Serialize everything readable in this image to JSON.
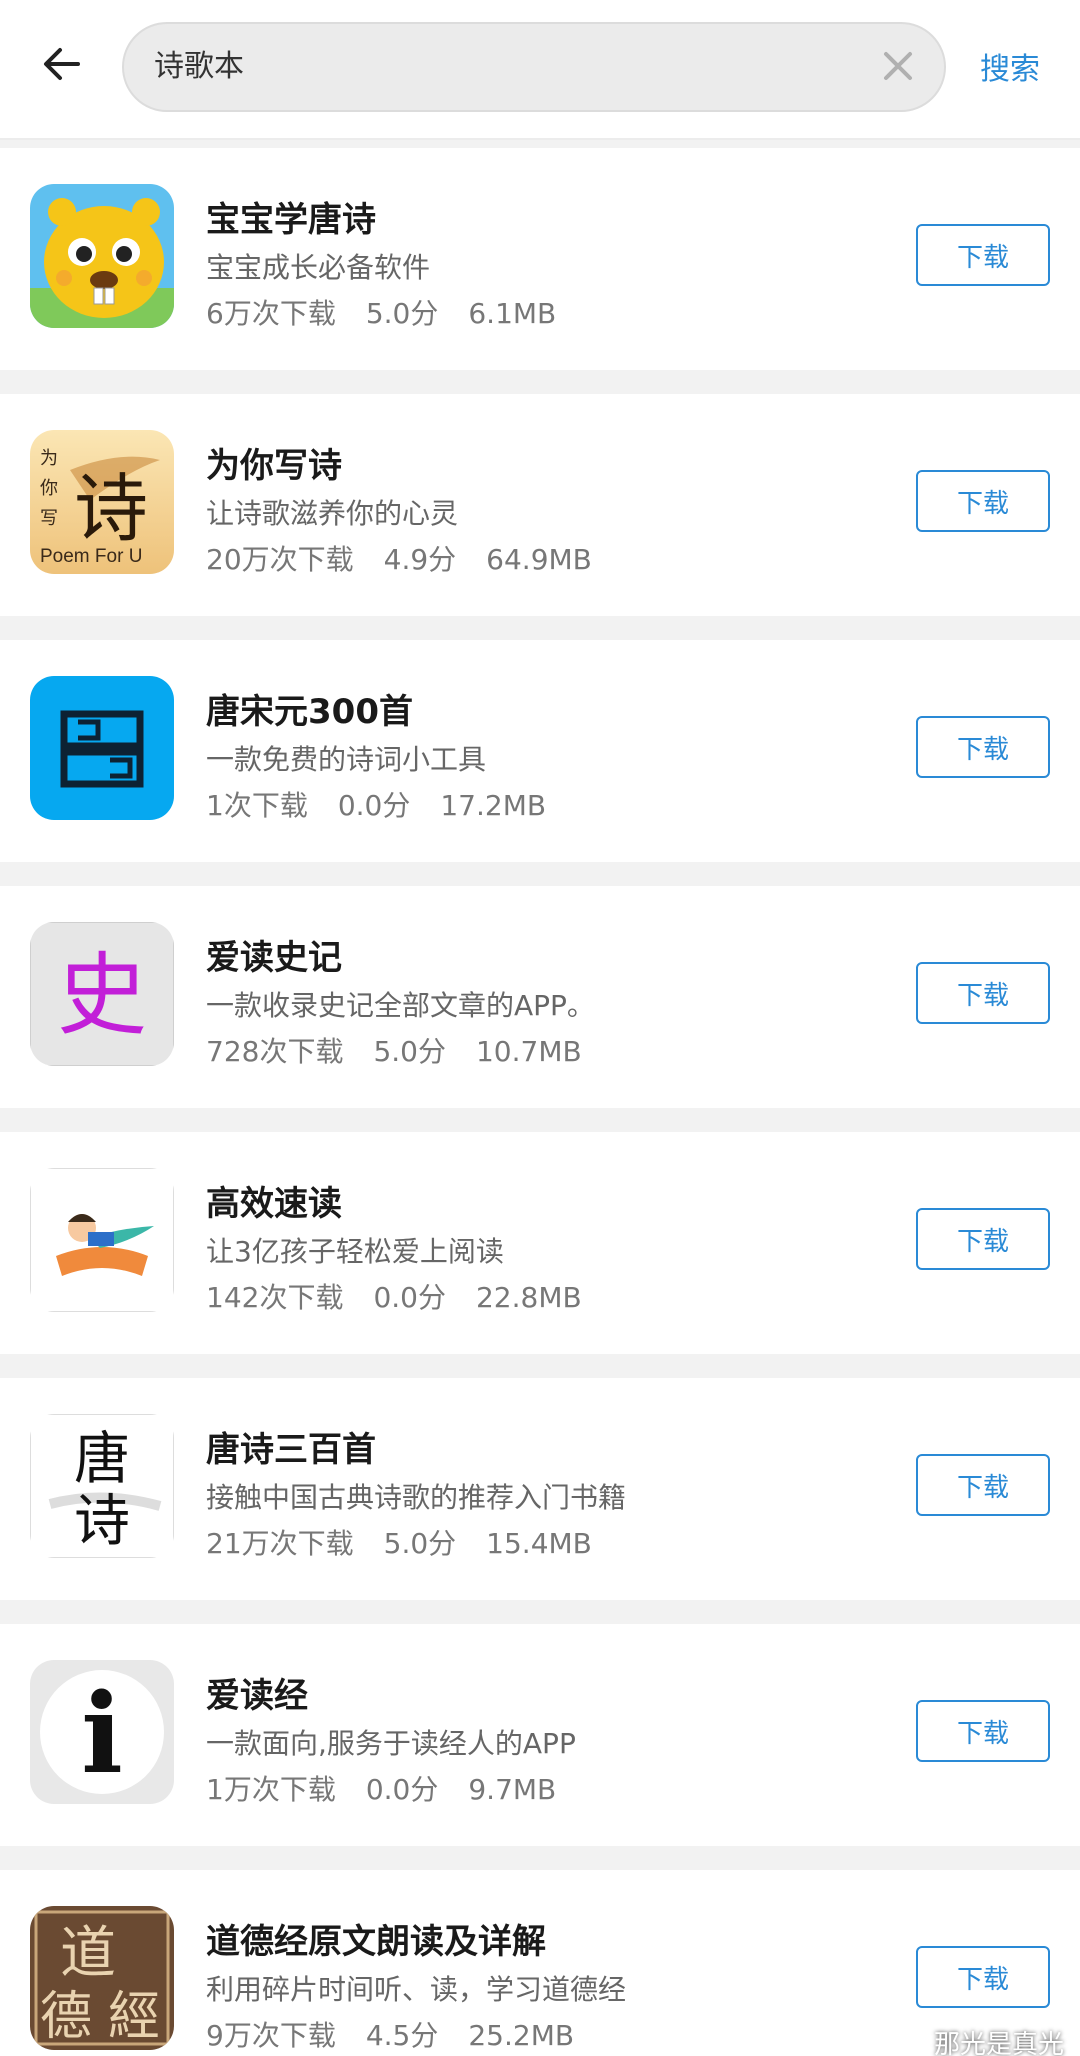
{
  "header": {
    "search_value": "诗歌本",
    "search_button": "搜索"
  },
  "apps": [
    {
      "name": "宝宝学唐诗",
      "desc": "宝宝成长必备软件",
      "downloads": "6万次下载",
      "rating": "5.0分",
      "size": "6.1MB",
      "button": "下载",
      "icon": "beaver-cartoon-icon"
    },
    {
      "name": "为你写诗",
      "desc": "让诗歌滋养你的心灵",
      "downloads": "20万次下载",
      "rating": "4.9分",
      "size": "64.9MB",
      "button": "下载",
      "icon": "poem-calligraphy-icon",
      "icon_text": "Poem For U",
      "icon_glyphs": [
        "为",
        "你",
        "写",
        "诗"
      ]
    },
    {
      "name": "唐宋元300首",
      "desc": "一款免费的诗词小工具",
      "downloads": "1次下载",
      "rating": "0.0分",
      "size": "17.2MB",
      "button": "下载",
      "icon": "book-stack-icon"
    },
    {
      "name": "爱读史记",
      "desc": "一款收录史记全部文章的APP。",
      "downloads": "728次下载",
      "rating": "5.0分",
      "size": "10.7MB",
      "button": "下载",
      "icon": "shi-character-icon",
      "icon_glyphs": [
        "史"
      ]
    },
    {
      "name": "高效速读",
      "desc": "让3亿孩子轻松爱上阅读",
      "downloads": "142次下载",
      "rating": "0.0分",
      "size": "22.8MB",
      "button": "下载",
      "icon": "child-reading-icon"
    },
    {
      "name": "唐诗三百首",
      "desc": "接触中国古典诗歌的推荐入门书籍",
      "downloads": "21万次下载",
      "rating": "5.0分",
      "size": "15.4MB",
      "button": "下载",
      "icon": "tangshi-calligraphy-icon",
      "icon_glyphs": [
        "唐",
        "诗"
      ]
    },
    {
      "name": "爱读经",
      "desc": "一款面向,服务于读经人的APP",
      "downloads": "1万次下载",
      "rating": "0.0分",
      "size": "9.7MB",
      "button": "下载",
      "icon": "letter-i-icon",
      "icon_glyphs": [
        "i"
      ]
    },
    {
      "name": "道德经原文朗读及详解",
      "desc": "利用碎片时间听、读，学习道德经",
      "downloads": "9万次下载",
      "rating": "4.5分",
      "size": "25.2MB",
      "button": "下载",
      "icon": "daodejing-seal-icon",
      "icon_glyphs": [
        "道",
        "德",
        "經"
      ]
    }
  ],
  "watermark": "那光是真光",
  "colors": {
    "accent": "#2a8ad6",
    "background": "#f2f2f2"
  }
}
